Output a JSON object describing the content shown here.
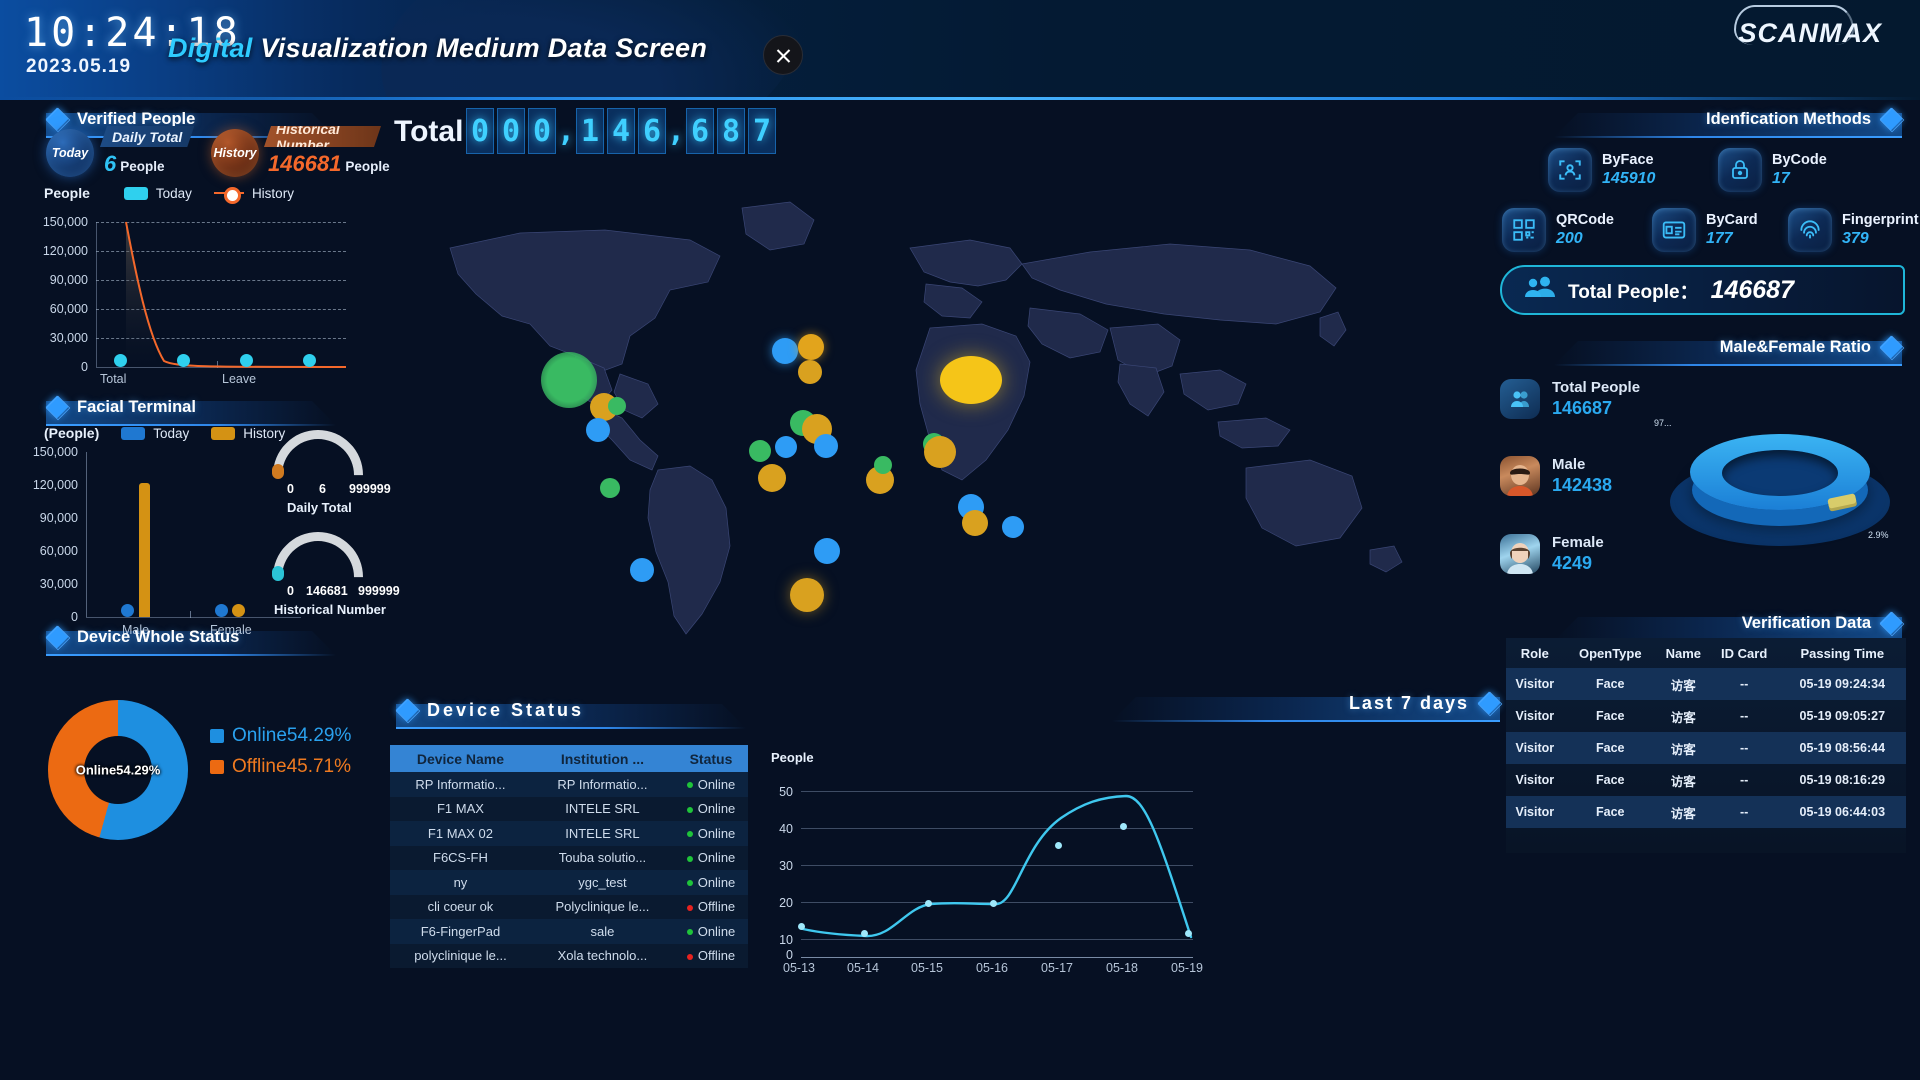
{
  "header": {
    "clock": "10:24:18",
    "date": "2023.05.19",
    "title_highlight": "Digital",
    "title_rest": "Visualization Medium Data Screen",
    "logo": "SCANMAX",
    "close_icon": "close-icon"
  },
  "total": {
    "label": "Total",
    "digits": [
      "0",
      "0",
      "0",
      ",",
      "1",
      "4",
      "6",
      ",",
      "6",
      "8",
      "7"
    ],
    "value": "000,146,687"
  },
  "verified_people": {
    "title": "Verified People",
    "today_badge": "Today",
    "daily_tag": "Daily Total",
    "daily_value": "6",
    "daily_unit": "People",
    "history_badge": "History",
    "hist_tag": "Historical Number",
    "hist_value": "146681",
    "hist_unit": "People",
    "axis_title": "People",
    "legend": [
      {
        "label": "Today",
        "color": "#2fd0ee",
        "type": "swatch"
      },
      {
        "label": "History",
        "color": "#f4682b",
        "type": "line"
      }
    ]
  },
  "facial_terminal": {
    "title": "Facial Terminal",
    "axis_title": "(People)",
    "legend": [
      {
        "label": "Today",
        "color": "#1f78d1"
      },
      {
        "label": "History",
        "color": "#d49214"
      }
    ],
    "gauges": [
      {
        "min": "0",
        "value": "6",
        "max": "999999",
        "caption": "Daily Total",
        "knob_color": "#d07a20"
      },
      {
        "min": "0",
        "value": "146681",
        "max": "999999",
        "caption": "Historical Number",
        "knob_color": "#2bc3d6"
      }
    ]
  },
  "device_whole_status": {
    "title": "Device Whole Status",
    "center_label": "Online54.29%",
    "legend": [
      {
        "label": "Online54.29%",
        "color": "#1e8fe0"
      },
      {
        "label": "Offline45.71%",
        "color": "#ec6a12"
      }
    ]
  },
  "device_status": {
    "title": "Device Status",
    "columns": [
      "Device Name",
      "Institution ...",
      "Status"
    ],
    "rows": [
      {
        "device": "RP Informatio...",
        "institution": "RP Informatio...",
        "status": "Online"
      },
      {
        "device": "F1 MAX",
        "institution": "INTELE SRL",
        "status": "Online"
      },
      {
        "device": "F1 MAX 02",
        "institution": "INTELE SRL",
        "status": "Online"
      },
      {
        "device": "F6CS-FH",
        "institution": "Touba solutio...",
        "status": "Online"
      },
      {
        "device": "ny",
        "institution": "ygc_test",
        "status": "Online"
      },
      {
        "device": "cli coeur ok",
        "institution": "Polyclinique le...",
        "status": "Offline"
      },
      {
        "device": "F6-FingerPad",
        "institution": "sale",
        "status": "Online"
      },
      {
        "device": "polyclinique le...",
        "institution": "Xola technolo...",
        "status": "Offline"
      }
    ],
    "status_colors": {
      "Online": "#1fc43a",
      "Offline": "#e8221f"
    }
  },
  "last7days": {
    "title": "Last 7 days",
    "axis_title": "People"
  },
  "identification_methods": {
    "title": "Idenfication Methods",
    "items": [
      {
        "name": "ByFace",
        "value": "145910",
        "icon": "face-scan-icon"
      },
      {
        "name": "ByCode",
        "value": "17",
        "icon": "lock-icon"
      },
      {
        "name": "QRCode",
        "value": "200",
        "icon": "qr-code-icon"
      },
      {
        "name": "ByCard",
        "value": "177",
        "icon": "card-icon"
      },
      {
        "name": "Fingerprint",
        "value": "379",
        "icon": "fingerprint-icon"
      }
    ]
  },
  "total_people_banner": {
    "icon": "people-icon",
    "label": "Total People：",
    "value": "146687"
  },
  "male_female_ratio": {
    "title": "Male&Female Ratio",
    "items": [
      {
        "name": "Total People",
        "value": "146687",
        "icon": "total-people-avatar"
      },
      {
        "name": "Male",
        "value": "142438",
        "icon": "male-avatar"
      },
      {
        "name": "Female",
        "value": "4249",
        "icon": "female-avatar"
      }
    ],
    "pie_labels": [
      "97...",
      "2.9%"
    ]
  },
  "verification_data": {
    "title": "Verification Data",
    "columns": [
      "Role",
      "OpenType",
      "Name",
      "ID Card",
      "Passing Time"
    ],
    "rows": [
      {
        "role": "Visitor",
        "opentype": "Face",
        "name": "访客",
        "idcard": "--",
        "time": "05-19 09:24:34"
      },
      {
        "role": "Visitor",
        "opentype": "Face",
        "name": "访客",
        "idcard": "--",
        "time": "05-19 09:05:27"
      },
      {
        "role": "Visitor",
        "opentype": "Face",
        "name": "访客",
        "idcard": "--",
        "time": "05-19 08:56:44"
      },
      {
        "role": "Visitor",
        "opentype": "Face",
        "name": "访客",
        "idcard": "--",
        "time": "05-19 08:16:29"
      },
      {
        "role": "Visitor",
        "opentype": "Face",
        "name": "访客",
        "idcard": "--",
        "time": "05-19 06:44:03"
      }
    ]
  },
  "chart_data": [
    {
      "type": "line",
      "name": "verified-people-chart",
      "title": "Verified People",
      "ylabel": "People",
      "categories": [
        "",
        "Total",
        "",
        "Leave",
        ""
      ],
      "yticks": [
        "0",
        "30,000",
        "60,000",
        "90,000",
        "120,000",
        "150,000"
      ],
      "ylim": [
        0,
        150000
      ],
      "series": [
        {
          "name": "History",
          "color": "#f4682b",
          "values": [
            148000,
            30000,
            2000,
            500,
            200
          ]
        },
        {
          "name": "Today",
          "color": "#2fd0ee",
          "values": [
            0,
            0,
            0,
            0,
            0
          ]
        }
      ],
      "grid": true,
      "legend_position": "top"
    },
    {
      "type": "bar",
      "name": "facial-terminal-chart",
      "title": "Facial Terminal",
      "ylabel": "(People)",
      "categories": [
        "Male",
        "Female"
      ],
      "yticks": [
        "0",
        "30,000",
        "60,000",
        "90,000",
        "120,000",
        "150,000"
      ],
      "ylim": [
        0,
        150000
      ],
      "series": [
        {
          "name": "Today",
          "color": "#1f78d1",
          "values": [
            4,
            2
          ]
        },
        {
          "name": "History",
          "color": "#d49214",
          "values": [
            138000,
            4249
          ]
        }
      ],
      "grid": false,
      "legend_position": "top"
    },
    {
      "type": "pie",
      "name": "device-whole-status-donut",
      "title": "Device Whole Status",
      "labels": [
        "Online54.29%",
        "Offline45.71%"
      ],
      "values": [
        54.29,
        45.71
      ],
      "colors": [
        "#1e8fe0",
        "#ec6a12"
      ]
    },
    {
      "type": "line",
      "name": "last-7-days-chart",
      "title": "Last 7 days",
      "ylabel": "People",
      "categories": [
        "05-13",
        "05-14",
        "05-15",
        "05-16",
        "05-17",
        "05-18",
        "05-19"
      ],
      "values": [
        8,
        6,
        17,
        17,
        38,
        43,
        6
      ],
      "yticks": [
        "0",
        "10",
        "20",
        "30",
        "40",
        "50"
      ],
      "ylim": [
        0,
        50
      ],
      "color": "#3fc8ef",
      "grid": true
    },
    {
      "type": "pie",
      "name": "male-female-ratio-3d-pie",
      "title": "Male&Female Ratio",
      "labels": [
        "Male",
        "Female"
      ],
      "values": [
        97.1,
        2.9
      ],
      "colors": [
        "#2095e8",
        "#d8cc6a"
      ]
    },
    {
      "type": "bar",
      "name": "identification-methods",
      "title": "Idenfication Methods",
      "categories": [
        "ByFace",
        "ByCode",
        "QRCode",
        "ByCard",
        "Fingerprint"
      ],
      "values": [
        145910,
        17,
        200,
        177,
        379
      ]
    }
  ]
}
